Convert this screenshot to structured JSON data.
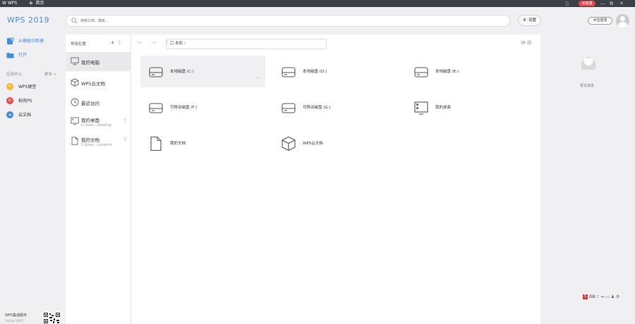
{
  "titlebar": {
    "app_tab": "W WPS",
    "new_tab": "首页",
    "membership_badge": "冰客服",
    "window_controls": [
      "▯",
      "—",
      "⧉",
      "✕"
    ]
  },
  "header": {
    "logo": "WPS 2019",
    "search_placeholder": "搜索文档、模板...",
    "settings_label": "设置",
    "login_label": "点击登录"
  },
  "sidebar": {
    "items": [
      {
        "label": "从模板中新建",
        "icon": "new-from-template-icon",
        "color": "#3c8ee6"
      },
      {
        "label": "打开",
        "icon": "folder-open-icon",
        "color": "#3c8ee6"
      }
    ],
    "apps_header": "应用中心",
    "apps_more": "更多 >",
    "apps": [
      {
        "label": "WPS便签",
        "icon": "sticky-note-icon",
        "color": "#f5b82e",
        "glyph": "✎"
      },
      {
        "label": "稻壳PS",
        "icon": "docer-ps-icon",
        "color": "#e8474b",
        "glyph": "PS"
      },
      {
        "label": "云文档",
        "icon": "cloud-doc-icon",
        "color": "#3c8ee6",
        "glyph": "☁"
      }
    ],
    "bottom_label": "WPS集成服务",
    "bottom_sub": "扫码关注我们"
  },
  "nav": {
    "title": "常用位置",
    "actions": "+  ⋮",
    "items": [
      {
        "label": "我的电脑",
        "sub": "",
        "icon": "computer-icon",
        "pin": ""
      },
      {
        "label": "WPS云文档",
        "sub": "",
        "icon": "cloud-box-icon",
        "pin": ""
      },
      {
        "label": "最近访问",
        "sub": "",
        "icon": "recent-clock-icon",
        "pin": ""
      },
      {
        "label": "我的桌面",
        "sub": "C:\\User...Desktop",
        "icon": "desktop-icon",
        "pin": "⚲"
      },
      {
        "label": "我的文档",
        "sub": "C:\\User...cuments",
        "icon": "documents-icon",
        "pin": "⚲"
      }
    ]
  },
  "toolbar": {
    "arrows": "← → ↑",
    "path": "本机 ›",
    "right_tools": "⟳ ☷"
  },
  "items": [
    {
      "name": "本地磁盘 (C:)",
      "icon": "hard-drive-icon",
      "dots": "···"
    },
    {
      "name": "本地磁盘 (D:)",
      "icon": "hard-drive-icon",
      "dots": ""
    },
    {
      "name": "本地磁盘 (E:)",
      "icon": "hard-drive-icon",
      "dots": ""
    },
    {
      "name": "可移动磁盘 (F:)",
      "icon": "removable-drive-icon",
      "dots": ""
    },
    {
      "name": "可移动磁盘 (G:)",
      "icon": "removable-drive-icon",
      "dots": ""
    },
    {
      "name": "我的桌面",
      "icon": "desktop-icon",
      "dots": ""
    },
    {
      "name": "我的文档",
      "icon": "document-icon",
      "dots": ""
    },
    {
      "name": "WPS云文档",
      "icon": "cloud-box-icon",
      "dots": ""
    }
  ],
  "right_panel": {
    "empty_text": "暂无消息"
  },
  "tray": {
    "badge": "S",
    "icons": "⌨ ♪ ↔ ▭ ♟ ⚙"
  }
}
